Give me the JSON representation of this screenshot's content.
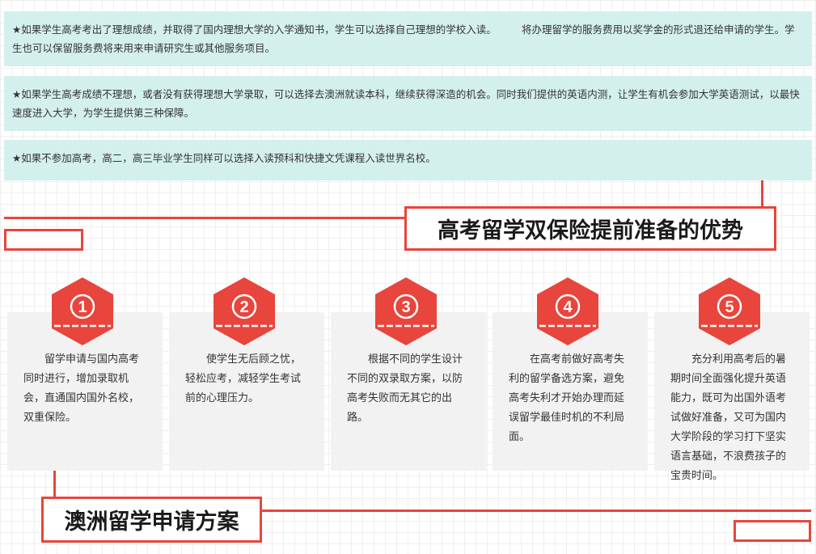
{
  "info_boxes": [
    "★如果学生高考考出了理想成绩，并取得了国内理想大学的入学通知书，学生可以选择自己理想的学校入读。　　　将办理留学的服务费用以奖学金的形式退还给申请的学生。学生也可以保留服务费将来用来申请研究生或其他服务项目。",
    "★如果学生高考成绩不理想，或者没有获得理想大学录取，可以选择去澳洲就读本科，继续获得深造的机会。同时我们提供的英语内测，让学生有机会参加大学英语测试，以最快速度进入大学，为学生提供第三种保障。",
    "★如果不参加高考，高二，高三毕业学生同样可以选择入读预科和快捷文凭课程入读世界名校。"
  ],
  "section_titles": {
    "advantages": "高考留学双保险提前准备的优势",
    "plan": "澳洲留学申请方案"
  },
  "cards": [
    {
      "number": "1",
      "text": "留学申请与国内高考同时进行，增加录取机会，直通国内国外名校，双重保险。"
    },
    {
      "number": "2",
      "text": "使学生无后顾之忧，轻松应考，减轻学生考试前的心理压力。"
    },
    {
      "number": "3",
      "text": "根据不同的学生设计不同的双录取方案，以防高考失败而无其它的出路。"
    },
    {
      "number": "4",
      "text": "在高考前做好高考失利的留学备选方案，避免高考失利才开始办理而延误留学最佳时机的不利局面。"
    },
    {
      "number": "5",
      "text": "充分利用高考后的暑期时间全面强化提升英语能力，既可为出国外语考试做好准备，又可为国内大学阶段的学习打下坚实语言基础，不浪费孩子的宝贵时间。"
    }
  ],
  "colors": {
    "accent_red": "#e8453c",
    "info_bg": "#d3f0ec",
    "card_bg": "#f2f2f2"
  },
  "icons": [
    "hexagon-number-badge"
  ]
}
